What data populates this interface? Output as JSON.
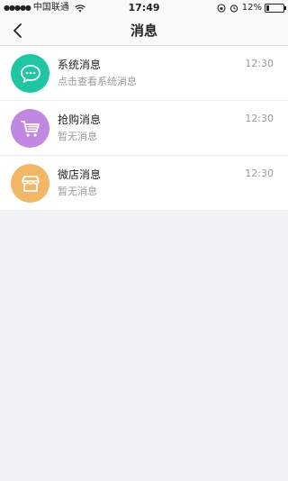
{
  "status_bar": {
    "signal": "●●●●●",
    "carrier": "中国联通",
    "time": "17:49",
    "battery": "12%"
  },
  "nav": {
    "title": "消息"
  },
  "messages": [
    {
      "title": "系统消息",
      "subtitle": "点击查看系统消息",
      "time": "12:30",
      "icon": "chat-bubble-icon",
      "color": "#1fc6a4"
    },
    {
      "title": "抢购消息",
      "subtitle": "暂无消息",
      "time": "12:30",
      "icon": "shopping-cart-icon",
      "color": "#c088e0"
    },
    {
      "title": "微店消息",
      "subtitle": "暂无消息",
      "time": "12:30",
      "icon": "store-icon",
      "color": "#f2b765"
    }
  ]
}
